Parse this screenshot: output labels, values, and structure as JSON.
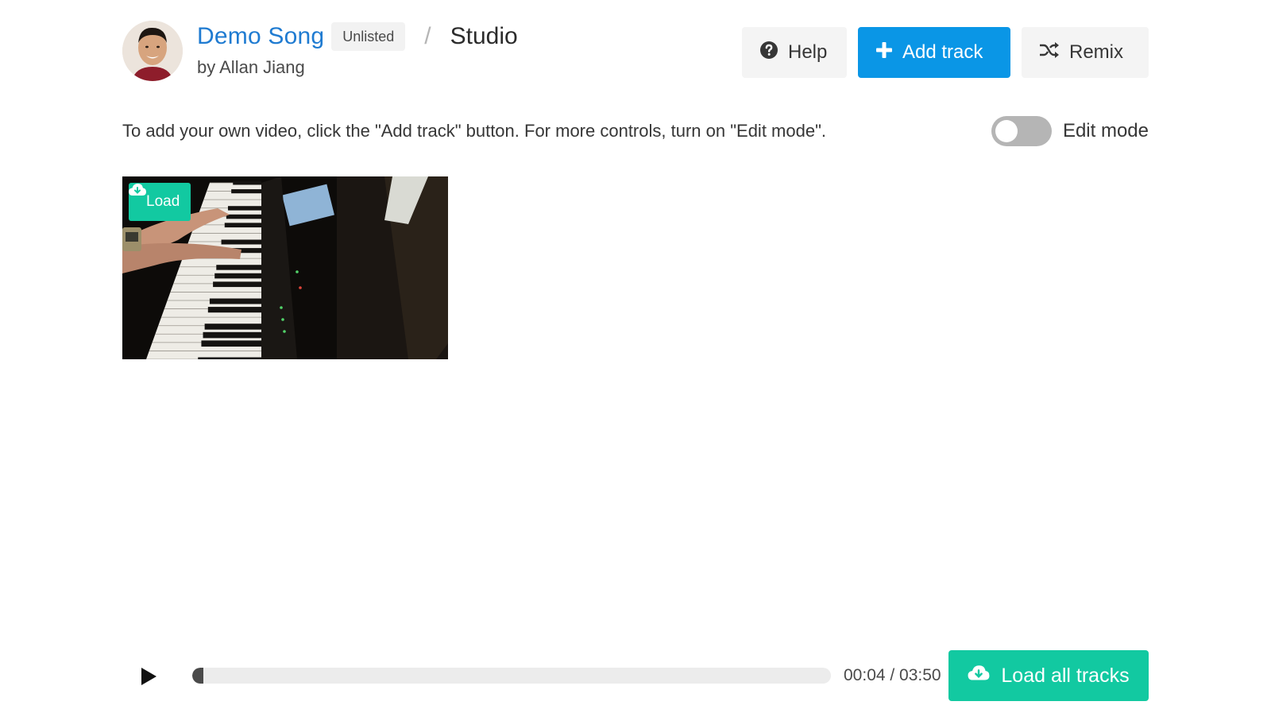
{
  "header": {
    "song_title": "Demo Song",
    "tag": "Unlisted",
    "separator": "/",
    "section": "Studio",
    "byline": "by Allan Jiang",
    "avatar_icon": "user-avatar"
  },
  "actions": {
    "help": {
      "label": "Help",
      "icon": "question-circle-icon"
    },
    "add_track": {
      "label": "Add track",
      "icon": "plus-icon"
    },
    "remix": {
      "label": "Remix",
      "icon": "shuffle-icon"
    }
  },
  "info": {
    "text": "To add your own video, click the \"Add track\" button. For more controls, turn on \"Edit mode\".",
    "edit_mode_label": "Edit mode",
    "edit_mode_on": false
  },
  "tracks": [
    {
      "load_label": "Load",
      "icon": "cloud-download-icon",
      "thumbnail": "piano-keyboard"
    }
  ],
  "player": {
    "play_icon": "play-icon",
    "progress": 0.017,
    "time": "00:04 / 03:50",
    "load_all_label": "Load all tracks",
    "load_all_icon": "cloud-download-icon"
  },
  "colors": {
    "primary": "#0a96e6",
    "accent": "#12c9a1",
    "link": "#1f7bd1"
  }
}
